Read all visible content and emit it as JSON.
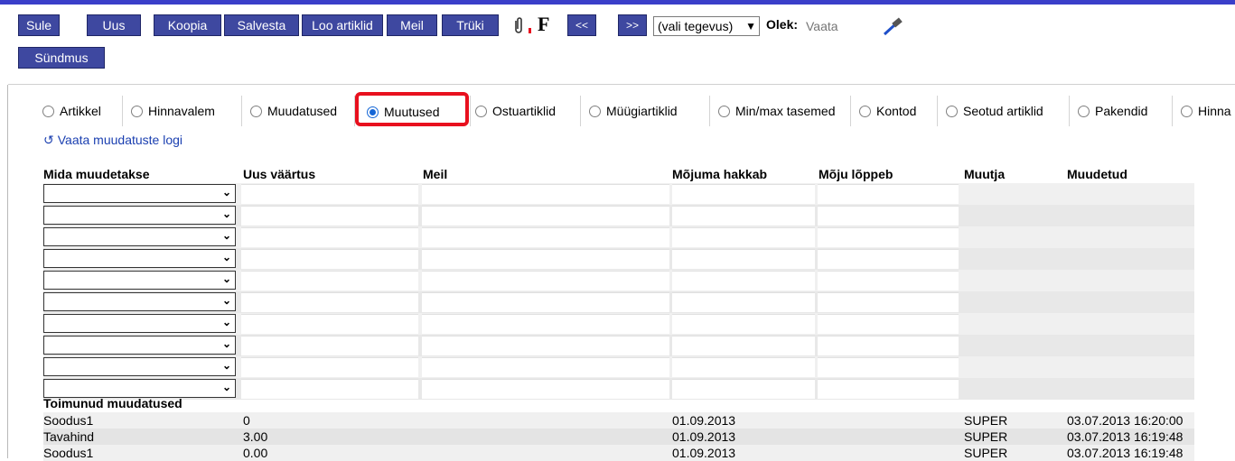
{
  "toolbar": {
    "buttons": [
      "Sule",
      "Uus",
      "Koopia",
      "Salvesta",
      "Loo artiklid",
      "Meil",
      "Trüki"
    ],
    "f_label": "F",
    "prev_label": "<<",
    "next_label": ">>",
    "action_select": "(vali tegevus)",
    "olek_label": "Olek:",
    "olek_placeholder": "Vaata",
    "event_button": "Sündmus"
  },
  "tabs": [
    {
      "label": "Artikkel",
      "selected": false
    },
    {
      "label": "Hinnavalem",
      "selected": false
    },
    {
      "label": "Muudatused",
      "selected": false
    },
    {
      "label": "Muutused",
      "selected": true
    },
    {
      "label": "Ostuartiklid",
      "selected": false
    },
    {
      "label": "Müügiartiklid",
      "selected": false
    },
    {
      "label": "Min/max tasemed",
      "selected": false
    },
    {
      "label": "Kontod",
      "selected": false
    },
    {
      "label": "Seotud artiklid",
      "selected": false
    },
    {
      "label": "Pakendid",
      "selected": false
    },
    {
      "label": "Hinna",
      "selected": false
    }
  ],
  "log_link": "Vaata muudatuste logi",
  "table": {
    "headers": [
      "Mida muudetakse",
      "Uus väärtus",
      "Meil",
      "Mõjuma hakkab",
      "Mõju lõppeb",
      "Muutja",
      "Muudetud"
    ],
    "empty_rows": 10
  },
  "history": {
    "title": "Toimunud muudatused",
    "rows": [
      {
        "field": "Soodus1",
        "value": "0",
        "start": "01.09.2013",
        "user": "SUPER",
        "changed": "03.07.2013 16:20:00"
      },
      {
        "field": "Tavahind",
        "value": "3.00",
        "start": "01.09.2013",
        "user": "SUPER",
        "changed": "03.07.2013 16:19:48"
      },
      {
        "field": "Soodus1",
        "value": "0.00",
        "start": "01.09.2013",
        "user": "SUPER",
        "changed": "03.07.2013 16:19:48"
      }
    ]
  },
  "colors": {
    "accent_bar": "#3a3fc9",
    "button_bg": "#3e48a0",
    "highlight": "#e8101e",
    "link": "#1a3fb0"
  }
}
